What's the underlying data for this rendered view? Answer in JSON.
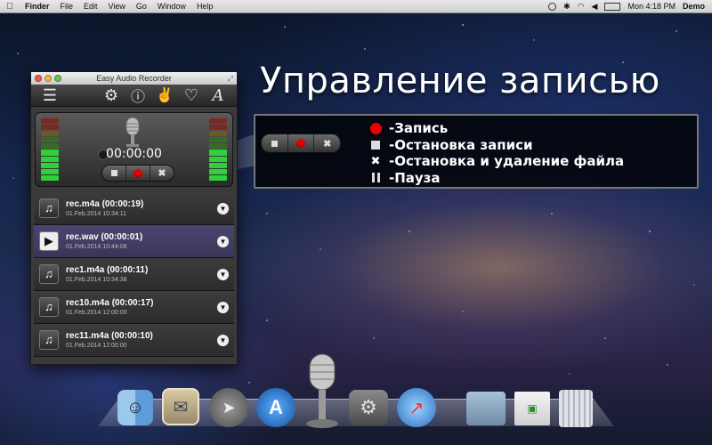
{
  "menubar": {
    "app": "Finder",
    "items": [
      "File",
      "Edit",
      "View",
      "Go",
      "Window",
      "Help"
    ],
    "clock": "Mon 4:18 PM",
    "user": "Demo"
  },
  "headline": "Управление записью",
  "window": {
    "title": "Easy Audio Recorder",
    "timer": "00:00:00",
    "toolbar_icons": [
      "list-icon",
      "gear-icon",
      "info-icon",
      "thumbs-up-icon",
      "heart-icon",
      "font-icon"
    ],
    "recordings": [
      {
        "name": "rec.m4a (00:00:19)",
        "date": "01.Feb.2014 10:34:11",
        "selected": false
      },
      {
        "name": "rec.wav (00:00:01)",
        "date": "01.Feb.2014 10:44:08",
        "selected": true
      },
      {
        "name": "rec1.m4a (00:00:11)",
        "date": "01.Feb.2014 10:34:38",
        "selected": false
      },
      {
        "name": "rec10.m4a (00:00:17)",
        "date": "01.Feb.2014 12:00:00",
        "selected": false
      },
      {
        "name": "rec11.m4a (00:00:10)",
        "date": "01.Feb.2014 12:00:00",
        "selected": false
      }
    ]
  },
  "legend": [
    {
      "symbol": "record",
      "label": "-Запись"
    },
    {
      "symbol": "stop",
      "label": "-Остановка записи"
    },
    {
      "symbol": "delete",
      "label": "-Остановка и удаление файла"
    },
    {
      "symbol": "pause",
      "label": "-Пауза"
    }
  ],
  "dock": [
    "finder-icon",
    "mail-icon",
    "launchpad-icon",
    "app-store-icon",
    "microphone-icon",
    "system-preferences-icon",
    "safari-icon",
    "applications-folder-icon",
    "documents-icon",
    "trash-icon"
  ],
  "colors": {
    "record": "#e00000",
    "selected_row": "#4b4670",
    "meter_green": "#2fd13a",
    "meter_red": "#c0392b"
  }
}
